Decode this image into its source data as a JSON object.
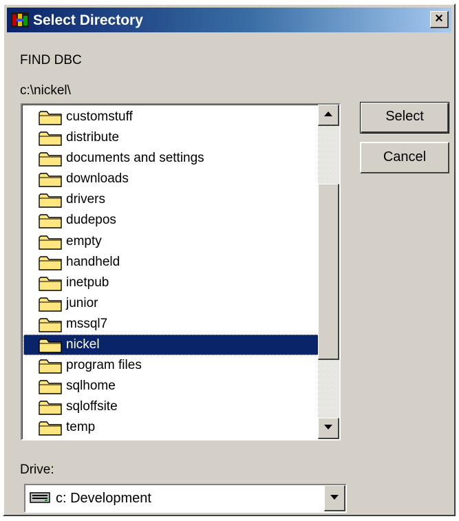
{
  "window": {
    "title": "Select Directory",
    "close_glyph": "×"
  },
  "prompt": "FIND DBC",
  "current_path": "c:\\nickel\\",
  "folders": [
    {
      "name": "customstuff"
    },
    {
      "name": "distribute"
    },
    {
      "name": "documents and settings"
    },
    {
      "name": "downloads"
    },
    {
      "name": "drivers"
    },
    {
      "name": "dudepos"
    },
    {
      "name": "empty"
    },
    {
      "name": "handheld"
    },
    {
      "name": "inetpub"
    },
    {
      "name": "junior"
    },
    {
      "name": "mssql7"
    },
    {
      "name": "nickel",
      "selected": true
    },
    {
      "name": "program files"
    },
    {
      "name": "sqlhome"
    },
    {
      "name": "sqloffsite"
    },
    {
      "name": "temp"
    }
  ],
  "buttons": {
    "select": "Select",
    "cancel": "Cancel"
  },
  "drive": {
    "label": "Drive:",
    "value": "c: Development"
  },
  "icons": {
    "folder": "folder-icon",
    "drive": "hard-drive-icon",
    "scroll_up": "arrow-up-icon",
    "scroll_down": "arrow-down-icon",
    "dropdown": "chevron-down-icon"
  },
  "colors": {
    "titlebar": "#0a246a",
    "selection": "#0a246a",
    "face": "#d4d0c8",
    "folder": "#ffe680"
  }
}
